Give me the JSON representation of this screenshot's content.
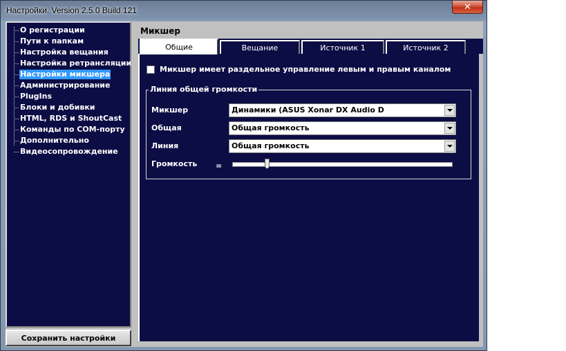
{
  "window": {
    "title": "Настройки. Version 2.5.0 Build 121",
    "close_glyph": "✕"
  },
  "sidebar": {
    "items": [
      {
        "label": "О регистрации",
        "selected": false
      },
      {
        "label": "Пути к папкам",
        "selected": false
      },
      {
        "label": "Настройка вещания",
        "selected": false
      },
      {
        "label": "Настройка ретрансляции",
        "selected": false
      },
      {
        "label": "Настройки микшера",
        "selected": true
      },
      {
        "label": "Администрирование",
        "selected": false
      },
      {
        "label": "PlugIns",
        "selected": false
      },
      {
        "label": "Блоки и добивки",
        "selected": false
      },
      {
        "label": "HTML, RDS и ShoutCast",
        "selected": false
      },
      {
        "label": "Команды по COM-порту",
        "selected": false
      },
      {
        "label": "Дополнительно",
        "selected": false
      },
      {
        "label": "Видеосопровождение",
        "selected": false
      }
    ],
    "save_label": "Сохранить настройки"
  },
  "panel": {
    "title": "Микшер",
    "tabs": [
      {
        "label": "Общие",
        "active": true
      },
      {
        "label": "Вещание",
        "active": false
      },
      {
        "label": "Источник 1",
        "active": false
      },
      {
        "label": "Источник 2",
        "active": false
      }
    ],
    "split_channels": {
      "label": "Микшер имеет раздельное управление левым и правым каналом",
      "checked": false
    },
    "group": {
      "legend": "Линия общей громкости",
      "mixer_label": "Микшер",
      "mixer_value": "Динамики (ASUS Xonar DX Audio D",
      "common_label": "Общая",
      "common_value": "Общая громкость",
      "line_label": "Линия",
      "line_value": "Общая громкость",
      "volume_label": "Громкость",
      "volume_eq": "=",
      "volume_level": 0.15
    }
  },
  "colors": {
    "panel_bg": "#0d0d45",
    "selection": "#3399ff",
    "chrome": "#c0c0c0"
  }
}
